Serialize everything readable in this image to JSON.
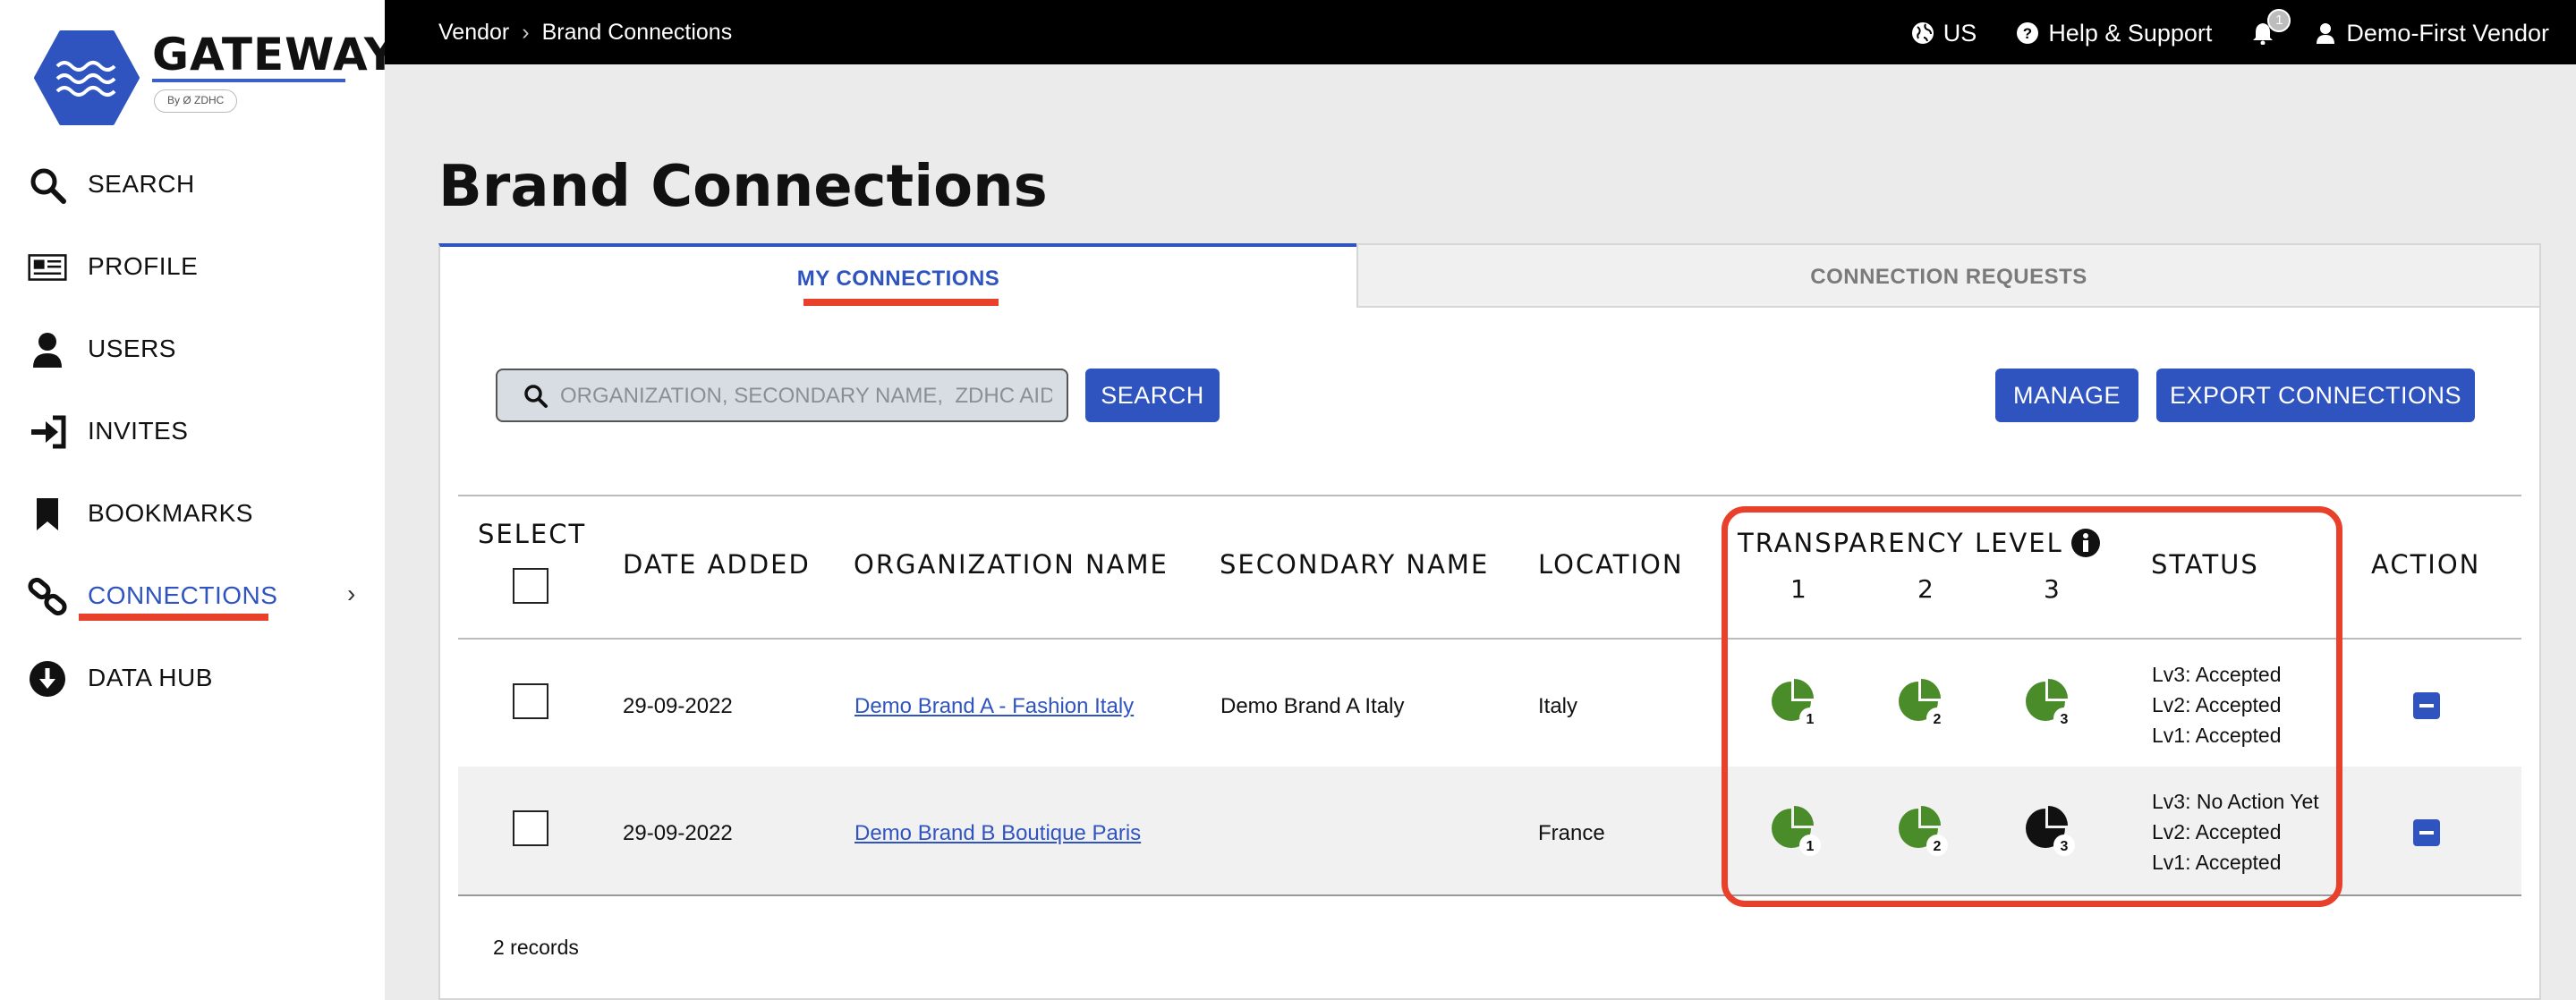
{
  "app": {
    "logo_word": "GATEWAY",
    "logo_by": "By Ø ZDHC"
  },
  "sidebar": {
    "items": [
      {
        "label": "SEARCH",
        "icon": "search-icon"
      },
      {
        "label": "PROFILE",
        "icon": "newspaper-icon"
      },
      {
        "label": "USERS",
        "icon": "user-icon"
      },
      {
        "label": "INVITES",
        "icon": "sign-in-icon"
      },
      {
        "label": "BOOKMARKS",
        "icon": "bookmark-icon"
      },
      {
        "label": "CONNECTIONS",
        "icon": "link-icon",
        "active": true
      },
      {
        "label": "DATA HUB",
        "icon": "download-circle-icon"
      }
    ]
  },
  "topbar": {
    "breadcrumb": [
      "Vendor",
      "Brand Connections"
    ],
    "region": "US",
    "help": "Help & Support",
    "notification_count": "1",
    "user": "Demo-First Vendor"
  },
  "page": {
    "title": "Brand Connections",
    "tabs": [
      "MY CONNECTIONS",
      "CONNECTION REQUESTS"
    ],
    "search_placeholder": "ORGANIZATION, SECONDARY NAME,  ZDHC AID",
    "search_button": "SEARCH",
    "manage_button": "MANAGE",
    "export_button": "EXPORT CONNECTIONS",
    "records": "2 records"
  },
  "table": {
    "headers": {
      "select": "SELECT",
      "date_added": "DATE ADDED",
      "organization": "ORGANIZATION NAME",
      "secondary": "SECONDARY NAME",
      "location": "LOCATION",
      "transparency": "TRANSPARENCY LEVEL",
      "levels": [
        "1",
        "2",
        "3"
      ],
      "status": "STATUS",
      "action": "ACTION"
    },
    "rows": [
      {
        "date": "29-09-2022",
        "organization": "Demo Brand A - Fashion Italy",
        "secondary": "Demo Brand A Italy",
        "location": "Italy",
        "levels": [
          {
            "level": "1",
            "state": "accepted"
          },
          {
            "level": "2",
            "state": "accepted"
          },
          {
            "level": "3",
            "state": "accepted"
          }
        ],
        "status": [
          "Lv3: Accepted",
          "Lv2: Accepted",
          "Lv1: Accepted"
        ]
      },
      {
        "date": "29-09-2022",
        "organization": "Demo Brand B Boutique Paris",
        "secondary": "",
        "location": "France",
        "levels": [
          {
            "level": "1",
            "state": "accepted"
          },
          {
            "level": "2",
            "state": "accepted"
          },
          {
            "level": "3",
            "state": "no-action"
          }
        ],
        "status": [
          "Lv3: No Action Yet",
          "Lv2: Accepted",
          "Lv1: Accepted"
        ]
      }
    ]
  },
  "colors": {
    "brand_blue": "#2f54c0",
    "accepted_green": "#4a8c2a",
    "no_action_black": "#111111",
    "highlight_red": "#e8402b"
  }
}
